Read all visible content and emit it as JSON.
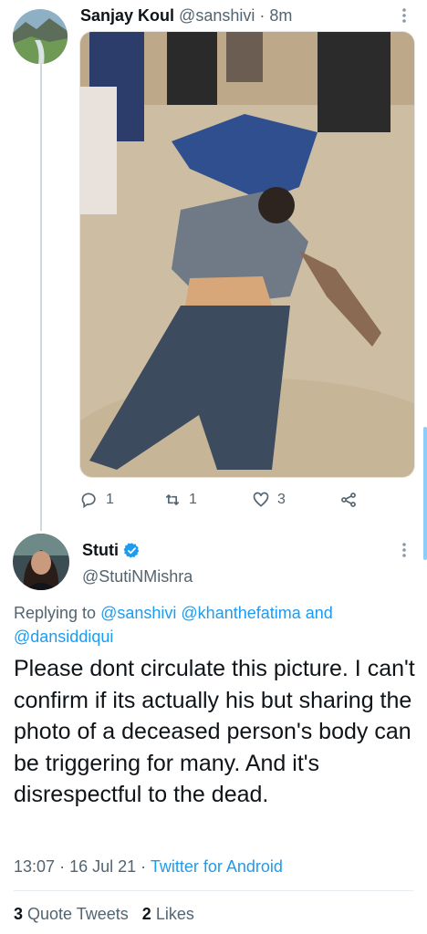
{
  "tweet1": {
    "author_name": "Sanjay Koul",
    "author_handle": "@sanshivi",
    "separator": "·",
    "time": "8m",
    "image_icon": "photo",
    "actions": {
      "reply_count": "1",
      "retweet_count": "1",
      "like_count": "3",
      "share_icon": "share-icon"
    }
  },
  "tweet2": {
    "author_name": "Stuti",
    "author_handle": "@StutiNMishra",
    "verified_icon": "verified-badge-icon",
    "replying_prefix": "Replying to",
    "mentions": [
      "@sanshivi",
      "@khanthefatima",
      "and",
      "@dansiddiqui"
    ],
    "text": "Please dont circulate this picture. I can't confirm if its actually his but sharing the photo of a deceased person's body can be triggering for many. And it's disrespectful to the dead.",
    "time": "13:07",
    "date": "16 Jul 21",
    "client": "Twitter for Android",
    "separator": "·"
  },
  "stats": {
    "quote_count": "3",
    "quote_label": "Quote Tweets",
    "like_count": "2",
    "like_label": "Likes"
  },
  "colors": {
    "accent": "#1d9bf0",
    "secondary_text": "#536471",
    "primary_text": "#0f1419"
  }
}
